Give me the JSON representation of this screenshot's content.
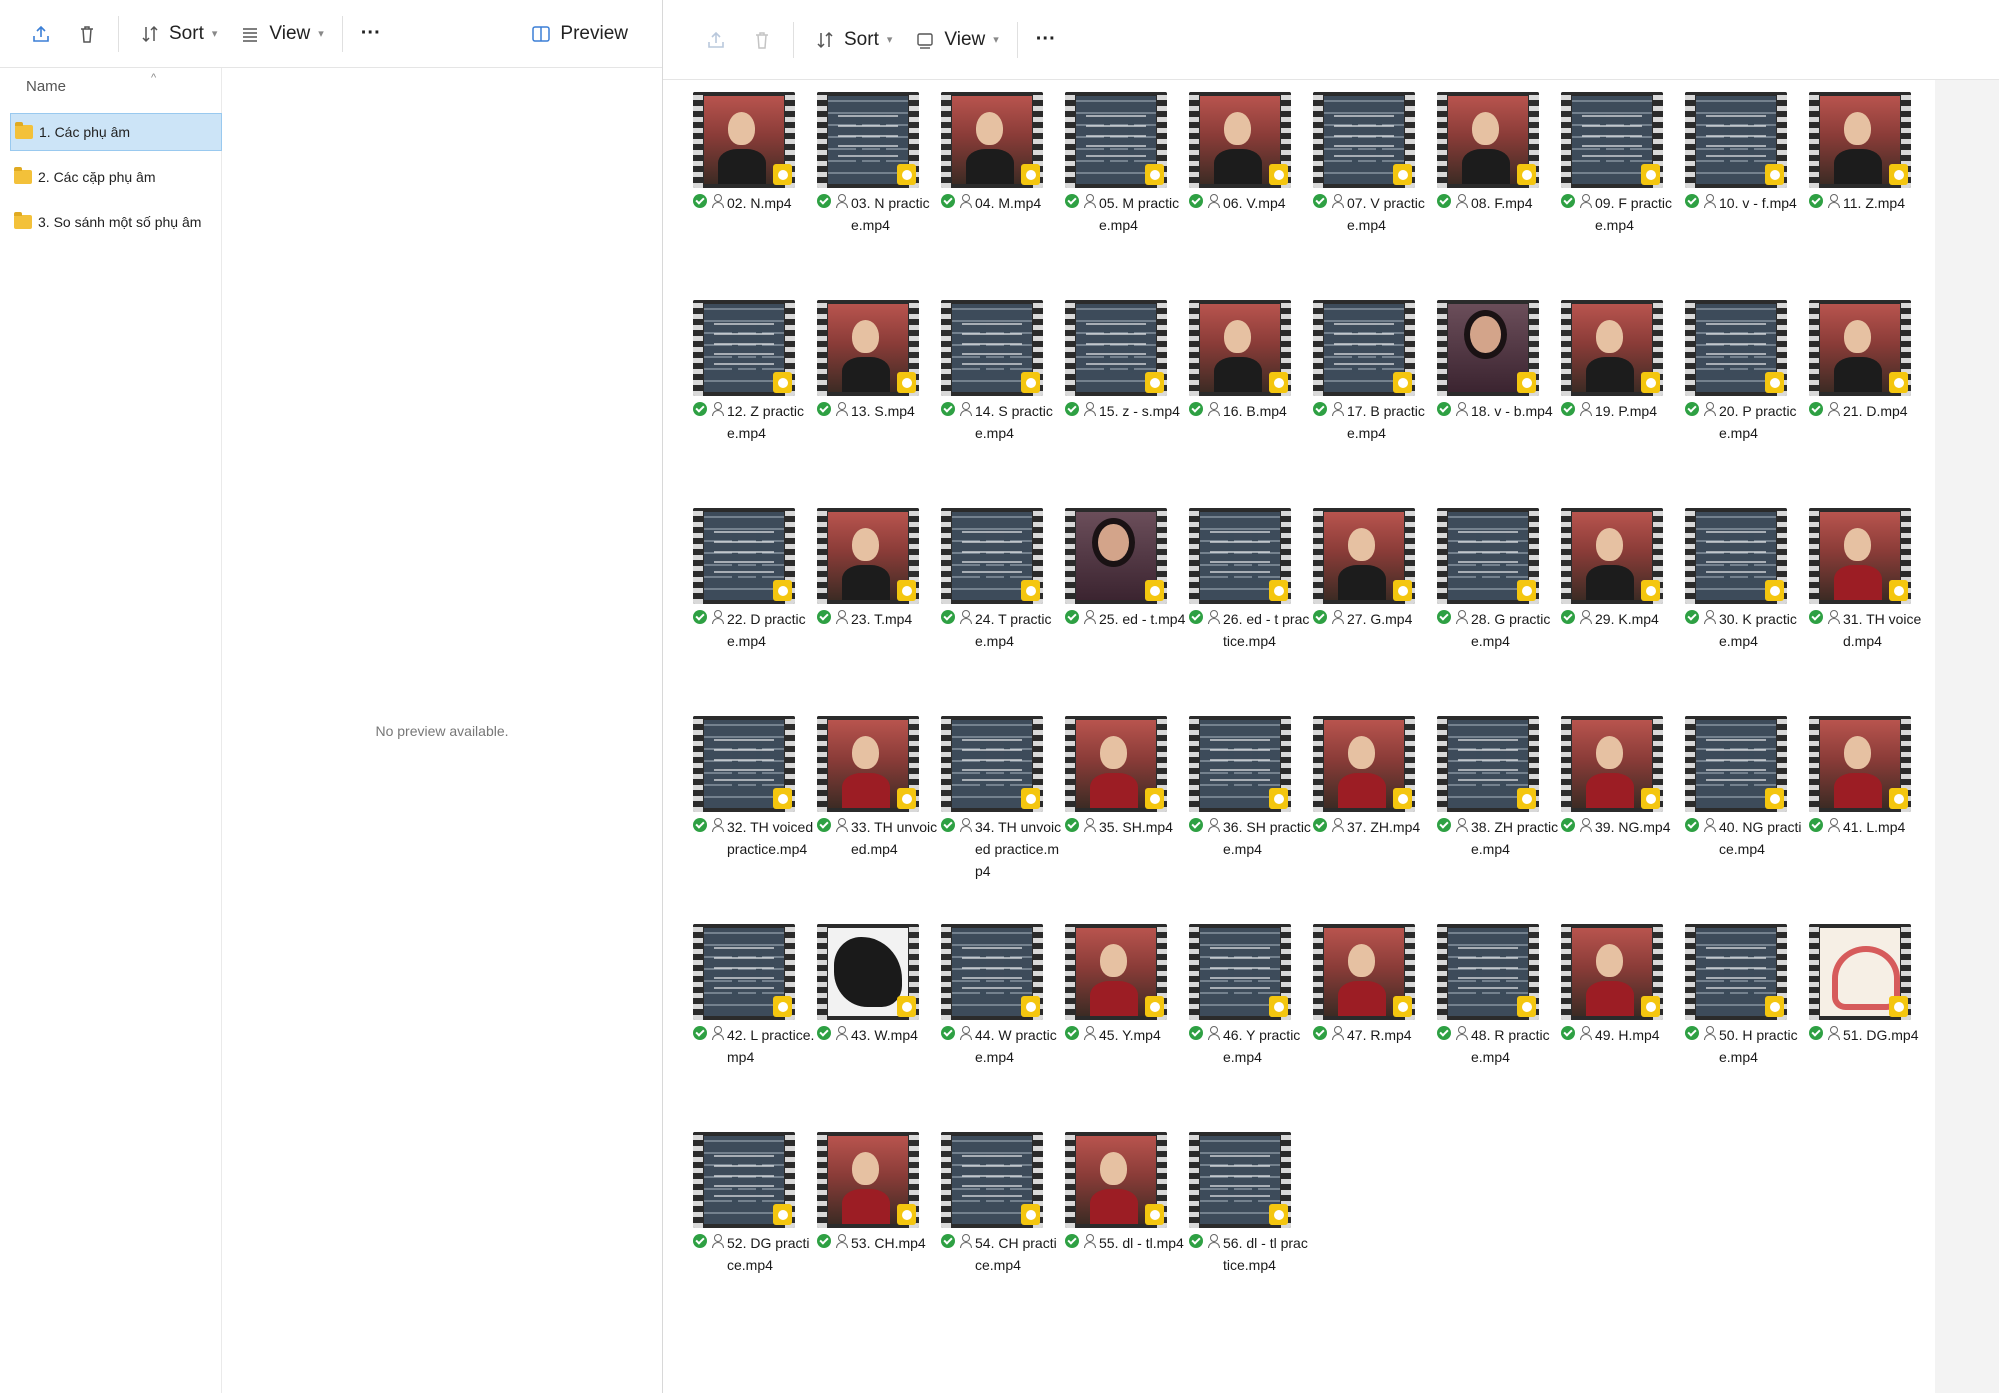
{
  "left_pane": {
    "toolbar": {
      "sort_label": "Sort",
      "view_label": "View",
      "more_label": "···",
      "preview_label": "Preview"
    },
    "tree": {
      "name_header": "Name",
      "items": [
        {
          "label": "1. Các phụ âm",
          "selected": true
        },
        {
          "label": "2. Các cặp phụ âm",
          "selected": false
        },
        {
          "label": "3. So sánh một số phụ âm",
          "selected": false
        }
      ]
    },
    "preview_message": "No preview available."
  },
  "right_pane": {
    "toolbar": {
      "sort_label": "Sort",
      "view_label": "View",
      "more_label": "···"
    },
    "files": [
      {
        "name": "02. N.mp4",
        "scene": "person"
      },
      {
        "name": "03. N practice.mp4",
        "scene": "text"
      },
      {
        "name": "04. M.mp4",
        "scene": "person"
      },
      {
        "name": "05. M practice.mp4",
        "scene": "text"
      },
      {
        "name": "06. V.mp4",
        "scene": "person"
      },
      {
        "name": "07. V practice.mp4",
        "scene": "text"
      },
      {
        "name": "08. F.mp4",
        "scene": "person"
      },
      {
        "name": "09. F practice.mp4",
        "scene": "text"
      },
      {
        "name": "10. v - f.mp4",
        "scene": "text"
      },
      {
        "name": "11. Z.mp4",
        "scene": "person"
      },
      {
        "name": "12. Z practice.mp4",
        "scene": "text"
      },
      {
        "name": "13. S.mp4",
        "scene": "person"
      },
      {
        "name": "14. S practice.mp4",
        "scene": "text"
      },
      {
        "name": "15. z - s.mp4",
        "scene": "text"
      },
      {
        "name": "16. B.mp4",
        "scene": "person"
      },
      {
        "name": "17. B practice.mp4",
        "scene": "text"
      },
      {
        "name": "18. v - b.mp4",
        "scene": "woman"
      },
      {
        "name": "19. P.mp4",
        "scene": "person"
      },
      {
        "name": "20. P practice.mp4",
        "scene": "text"
      },
      {
        "name": "21. D.mp4",
        "scene": "person"
      },
      {
        "name": "22. D practice.mp4",
        "scene": "text"
      },
      {
        "name": "23. T.mp4",
        "scene": "person"
      },
      {
        "name": "24. T practice.mp4",
        "scene": "text"
      },
      {
        "name": "25. ed - t.mp4",
        "scene": "woman"
      },
      {
        "name": "26. ed - t practice.mp4",
        "scene": "text"
      },
      {
        "name": "27. G.mp4",
        "scene": "person"
      },
      {
        "name": "28. G practice.mp4",
        "scene": "text"
      },
      {
        "name": "29. K.mp4",
        "scene": "person"
      },
      {
        "name": "30. K practice.mp4",
        "scene": "text"
      },
      {
        "name": "31. TH voiced.mp4",
        "scene": "red"
      },
      {
        "name": "32. TH voiced practice.mp4",
        "scene": "text"
      },
      {
        "name": "33. TH unvoiced.mp4",
        "scene": "red"
      },
      {
        "name": "34. TH unvoiced practice.mp4",
        "scene": "text"
      },
      {
        "name": "35. SH.mp4",
        "scene": "red"
      },
      {
        "name": "36. SH practice.mp4",
        "scene": "text"
      },
      {
        "name": "37. ZH.mp4",
        "scene": "red"
      },
      {
        "name": "38. ZH practice.mp4",
        "scene": "text"
      },
      {
        "name": "39. NG.mp4",
        "scene": "red"
      },
      {
        "name": "40. NG practice.mp4",
        "scene": "text"
      },
      {
        "name": "41. L.mp4",
        "scene": "red"
      },
      {
        "name": "42. L practice.mp4",
        "scene": "text"
      },
      {
        "name": "43. W.mp4",
        "scene": "mouth"
      },
      {
        "name": "44. W practice.mp4",
        "scene": "text"
      },
      {
        "name": "45. Y.mp4",
        "scene": "red"
      },
      {
        "name": "46. Y practice.mp4",
        "scene": "text"
      },
      {
        "name": "47. R.mp4",
        "scene": "red"
      },
      {
        "name": "48. R practice.mp4",
        "scene": "text"
      },
      {
        "name": "49. H.mp4",
        "scene": "red"
      },
      {
        "name": "50. H practice.mp4",
        "scene": "text"
      },
      {
        "name": "51. DG.mp4",
        "scene": "diagram"
      },
      {
        "name": "52. DG practice.mp4",
        "scene": "text"
      },
      {
        "name": "53. CH.mp4",
        "scene": "red"
      },
      {
        "name": "54. CH practice.mp4",
        "scene": "text"
      },
      {
        "name": "55. dl - tl.mp4",
        "scene": "red"
      },
      {
        "name": "56. dl - tl practice.mp4",
        "scene": "text"
      }
    ]
  }
}
